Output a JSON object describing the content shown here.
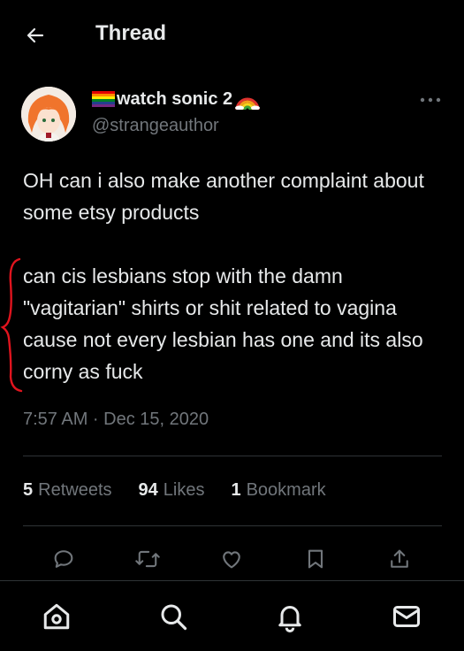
{
  "header": {
    "title": "Thread",
    "back_icon": "arrow-left-icon"
  },
  "author": {
    "display_name": "watch sonic 2",
    "name_prefix_emoji": "rainbow-flag-icon",
    "name_suffix_emoji": "rainbow-icon",
    "handle": "@strangeauthor",
    "more_icon": "more-dots-icon"
  },
  "tweet": {
    "paragraphs": [
      "OH can i also make another complaint about some etsy products",
      "can cis lesbians stop with the damn \"vagitarian\" shirts or shit related to vagina cause not every lesbian has one and its also corny as fuck"
    ],
    "timestamp": "7:57 AM · Dec 15, 2020",
    "annotation_color": "#e0141e"
  },
  "stats": {
    "retweets_count": "5",
    "retweets_label": "Retweets",
    "likes_count": "94",
    "likes_label": "Likes",
    "bookmarks_count": "1",
    "bookmarks_label": "Bookmark"
  },
  "actions": [
    "reply-icon",
    "retweet-icon",
    "like-icon",
    "bookmark-icon",
    "share-icon"
  ],
  "bottom_nav": [
    "home-icon",
    "search-icon",
    "notifications-icon",
    "messages-icon"
  ],
  "colors": {
    "background": "#000000",
    "text": "#e7e9ea",
    "secondary": "#71767b",
    "divider": "#2f3336"
  }
}
